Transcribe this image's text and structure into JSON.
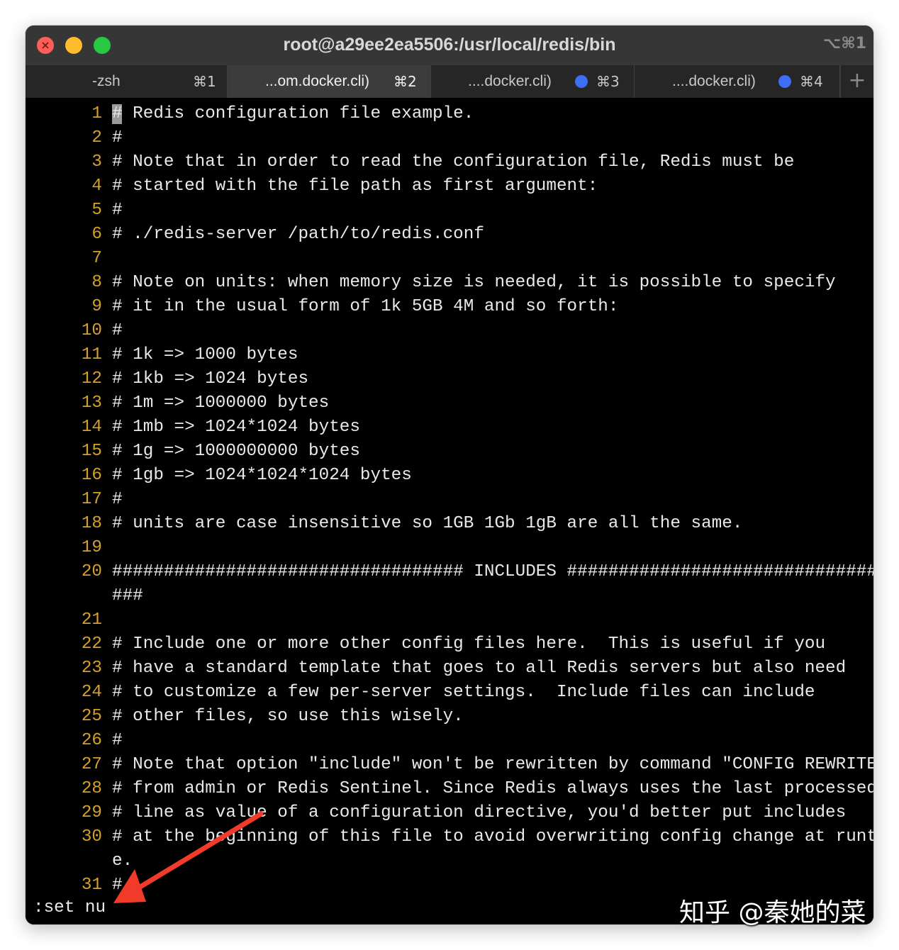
{
  "window": {
    "title": "root@a29ee2ea5506:/usr/local/redis/bin",
    "title_shortcut": "⌥⌘1",
    "close_glyph": "×"
  },
  "tabs": [
    {
      "label": "-zsh",
      "shortcut": "⌘1",
      "active": false,
      "dot": false
    },
    {
      "label": "...om.docker.cli)",
      "shortcut": "⌘2",
      "active": true,
      "dot": false
    },
    {
      "label": "....docker.cli)",
      "shortcut": "⌘3",
      "active": false,
      "dot": true
    },
    {
      "label": "....docker.cli)",
      "shortcut": "⌘4",
      "active": false,
      "dot": true
    }
  ],
  "new_tab_label": "+",
  "colors": {
    "line_number": "#d3a02c",
    "tab_dot": "#3d6ef5",
    "arrow": "#f03a2a"
  },
  "lines": [
    {
      "num": "1",
      "text": "# Redis configuration file example."
    },
    {
      "num": "2",
      "text": "#"
    },
    {
      "num": "3",
      "text": "# Note that in order to read the configuration file, Redis must be"
    },
    {
      "num": "4",
      "text": "# started with the file path as first argument:"
    },
    {
      "num": "5",
      "text": "#"
    },
    {
      "num": "6",
      "text": "# ./redis-server /path/to/redis.conf"
    },
    {
      "num": "7",
      "text": ""
    },
    {
      "num": "8",
      "text": "# Note on units: when memory size is needed, it is possible to specify"
    },
    {
      "num": "9",
      "text": "# it in the usual form of 1k 5GB 4M and so forth:"
    },
    {
      "num": "10",
      "text": "#"
    },
    {
      "num": "11",
      "text": "# 1k => 1000 bytes"
    },
    {
      "num": "12",
      "text": "# 1kb => 1024 bytes"
    },
    {
      "num": "13",
      "text": "# 1m => 1000000 bytes"
    },
    {
      "num": "14",
      "text": "# 1mb => 1024*1024 bytes"
    },
    {
      "num": "15",
      "text": "# 1g => 1000000000 bytes"
    },
    {
      "num": "16",
      "text": "# 1gb => 1024*1024*1024 bytes"
    },
    {
      "num": "17",
      "text": "#"
    },
    {
      "num": "18",
      "text": "# units are case insensitive so 1GB 1Gb 1gB are all the same."
    },
    {
      "num": "19",
      "text": ""
    },
    {
      "num": "20",
      "text": "################################## INCLUDES ################################"
    },
    {
      "num": "",
      "text": "###"
    },
    {
      "num": "21",
      "text": ""
    },
    {
      "num": "22",
      "text": "# Include one or more other config files here.  This is useful if you"
    },
    {
      "num": "23",
      "text": "# have a standard template that goes to all Redis servers but also need"
    },
    {
      "num": "24",
      "text": "# to customize a few per-server settings.  Include files can include"
    },
    {
      "num": "25",
      "text": "# other files, so use this wisely."
    },
    {
      "num": "26",
      "text": "#"
    },
    {
      "num": "27",
      "text": "# Note that option \"include\" won't be rewritten by command \"CONFIG REWRITE\""
    },
    {
      "num": "28",
      "text": "# from admin or Redis Sentinel. Since Redis always uses the last processed"
    },
    {
      "num": "29",
      "text": "# line as value of a configuration directive, you'd better put includes"
    },
    {
      "num": "30",
      "text": "# at the beginning of this file to avoid overwriting config change at runtim"
    },
    {
      "num": "",
      "text": "e."
    },
    {
      "num": "31",
      "text": "#"
    }
  ],
  "command_line": ":set nu",
  "watermark": "知乎 @秦她的菜"
}
